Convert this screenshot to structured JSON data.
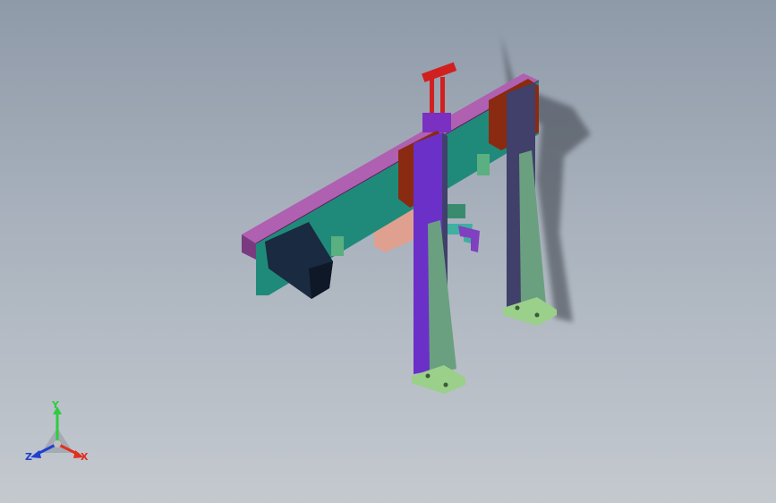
{
  "window": {
    "title": ""
  },
  "triad": {
    "axes": [
      {
        "label": "Y",
        "color": "#2ecc40"
      },
      {
        "label": "X",
        "color": "#e03020"
      },
      {
        "label": "Z",
        "color": "#2040d0"
      }
    ]
  },
  "colors": {
    "beam_top": "#b060b0",
    "beam_front": "#208a7a",
    "upright": "#6a30c8",
    "upright_dark": "#40406a",
    "gusset": "#6aa080",
    "base_plate": "#9ad08a",
    "carriage": "#8a2a10",
    "cylinder": "#d02020",
    "motor": "#1a2a40",
    "bracket": "#e0a090",
    "clamp": "#5ab080"
  }
}
